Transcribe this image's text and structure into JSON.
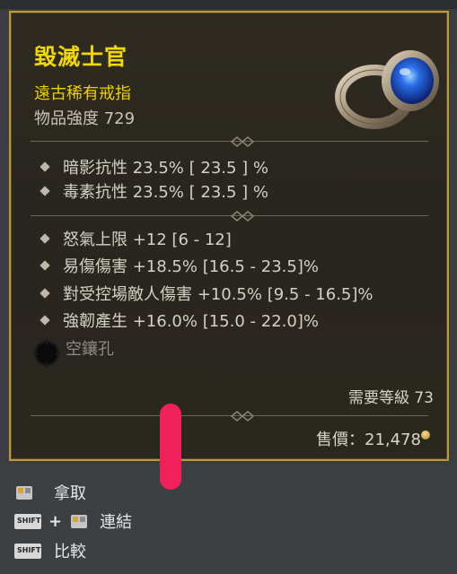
{
  "item": {
    "name": "毀滅士官",
    "type": "遠古稀有戒指",
    "power": "物品強度 729",
    "implicit_stats": [
      {
        "text": "暗影抗性 23.5%  [ 23.5 ] %"
      },
      {
        "text": "毒素抗性 23.5%  [ 23.5 ] %"
      }
    ],
    "affixes": [
      {
        "text": "怒氣上限 +12 [6 - 12]"
      },
      {
        "text": "易傷傷害 +18.5% [16.5 - 23.5]%"
      },
      {
        "text": "對受控場敵人傷害 +10.5% [9.5 - 16.5]%"
      },
      {
        "text": "強韌產生 +16.0% [15.0 - 22.0]%"
      }
    ],
    "socket": "空鑲孔",
    "required_level": "需要等級 73",
    "sell_price": "售價：21,478"
  },
  "actions": {
    "pickup": "拿取",
    "link": "連結",
    "link_modifier": "+",
    "compare": "比較",
    "shift_label": "SHIFT"
  },
  "colors": {
    "title": "#f2d800",
    "rarity": "#f0d000",
    "frame": "#b89a44"
  }
}
